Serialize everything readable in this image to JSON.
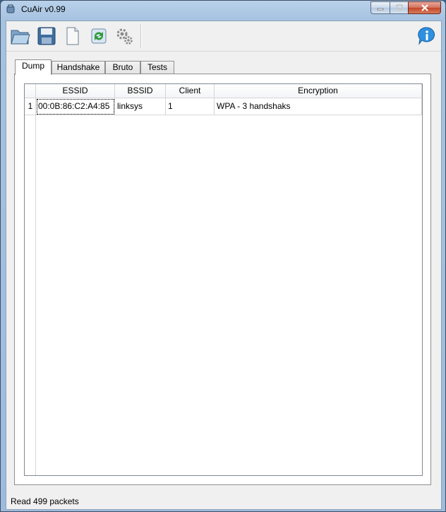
{
  "window": {
    "title": "CuAir v0.99"
  },
  "toolbar": {
    "buttons": [
      "open-folder",
      "save-floppy",
      "new-document",
      "refresh",
      "settings-gears"
    ],
    "right_button": "info"
  },
  "tabs": [
    {
      "label": "Dump",
      "active": true
    },
    {
      "label": "Handshake",
      "active": false
    },
    {
      "label": "Bruto",
      "active": false
    },
    {
      "label": "Tests",
      "active": false
    }
  ],
  "table": {
    "columns": [
      "ESSID",
      "BSSID",
      "Client",
      "Encryption"
    ],
    "rows": [
      {
        "num": "1",
        "essid": "00:0B:86:C2:A4:85",
        "bssid": "linksys",
        "client": "1",
        "encryption": "WPA - 3 handshaks"
      }
    ]
  },
  "status": {
    "text": "Read 499 packets"
  },
  "colors": {
    "titlebar": "#b9d1ea",
    "close": "#c1452c",
    "client": "#f0f0f0"
  }
}
